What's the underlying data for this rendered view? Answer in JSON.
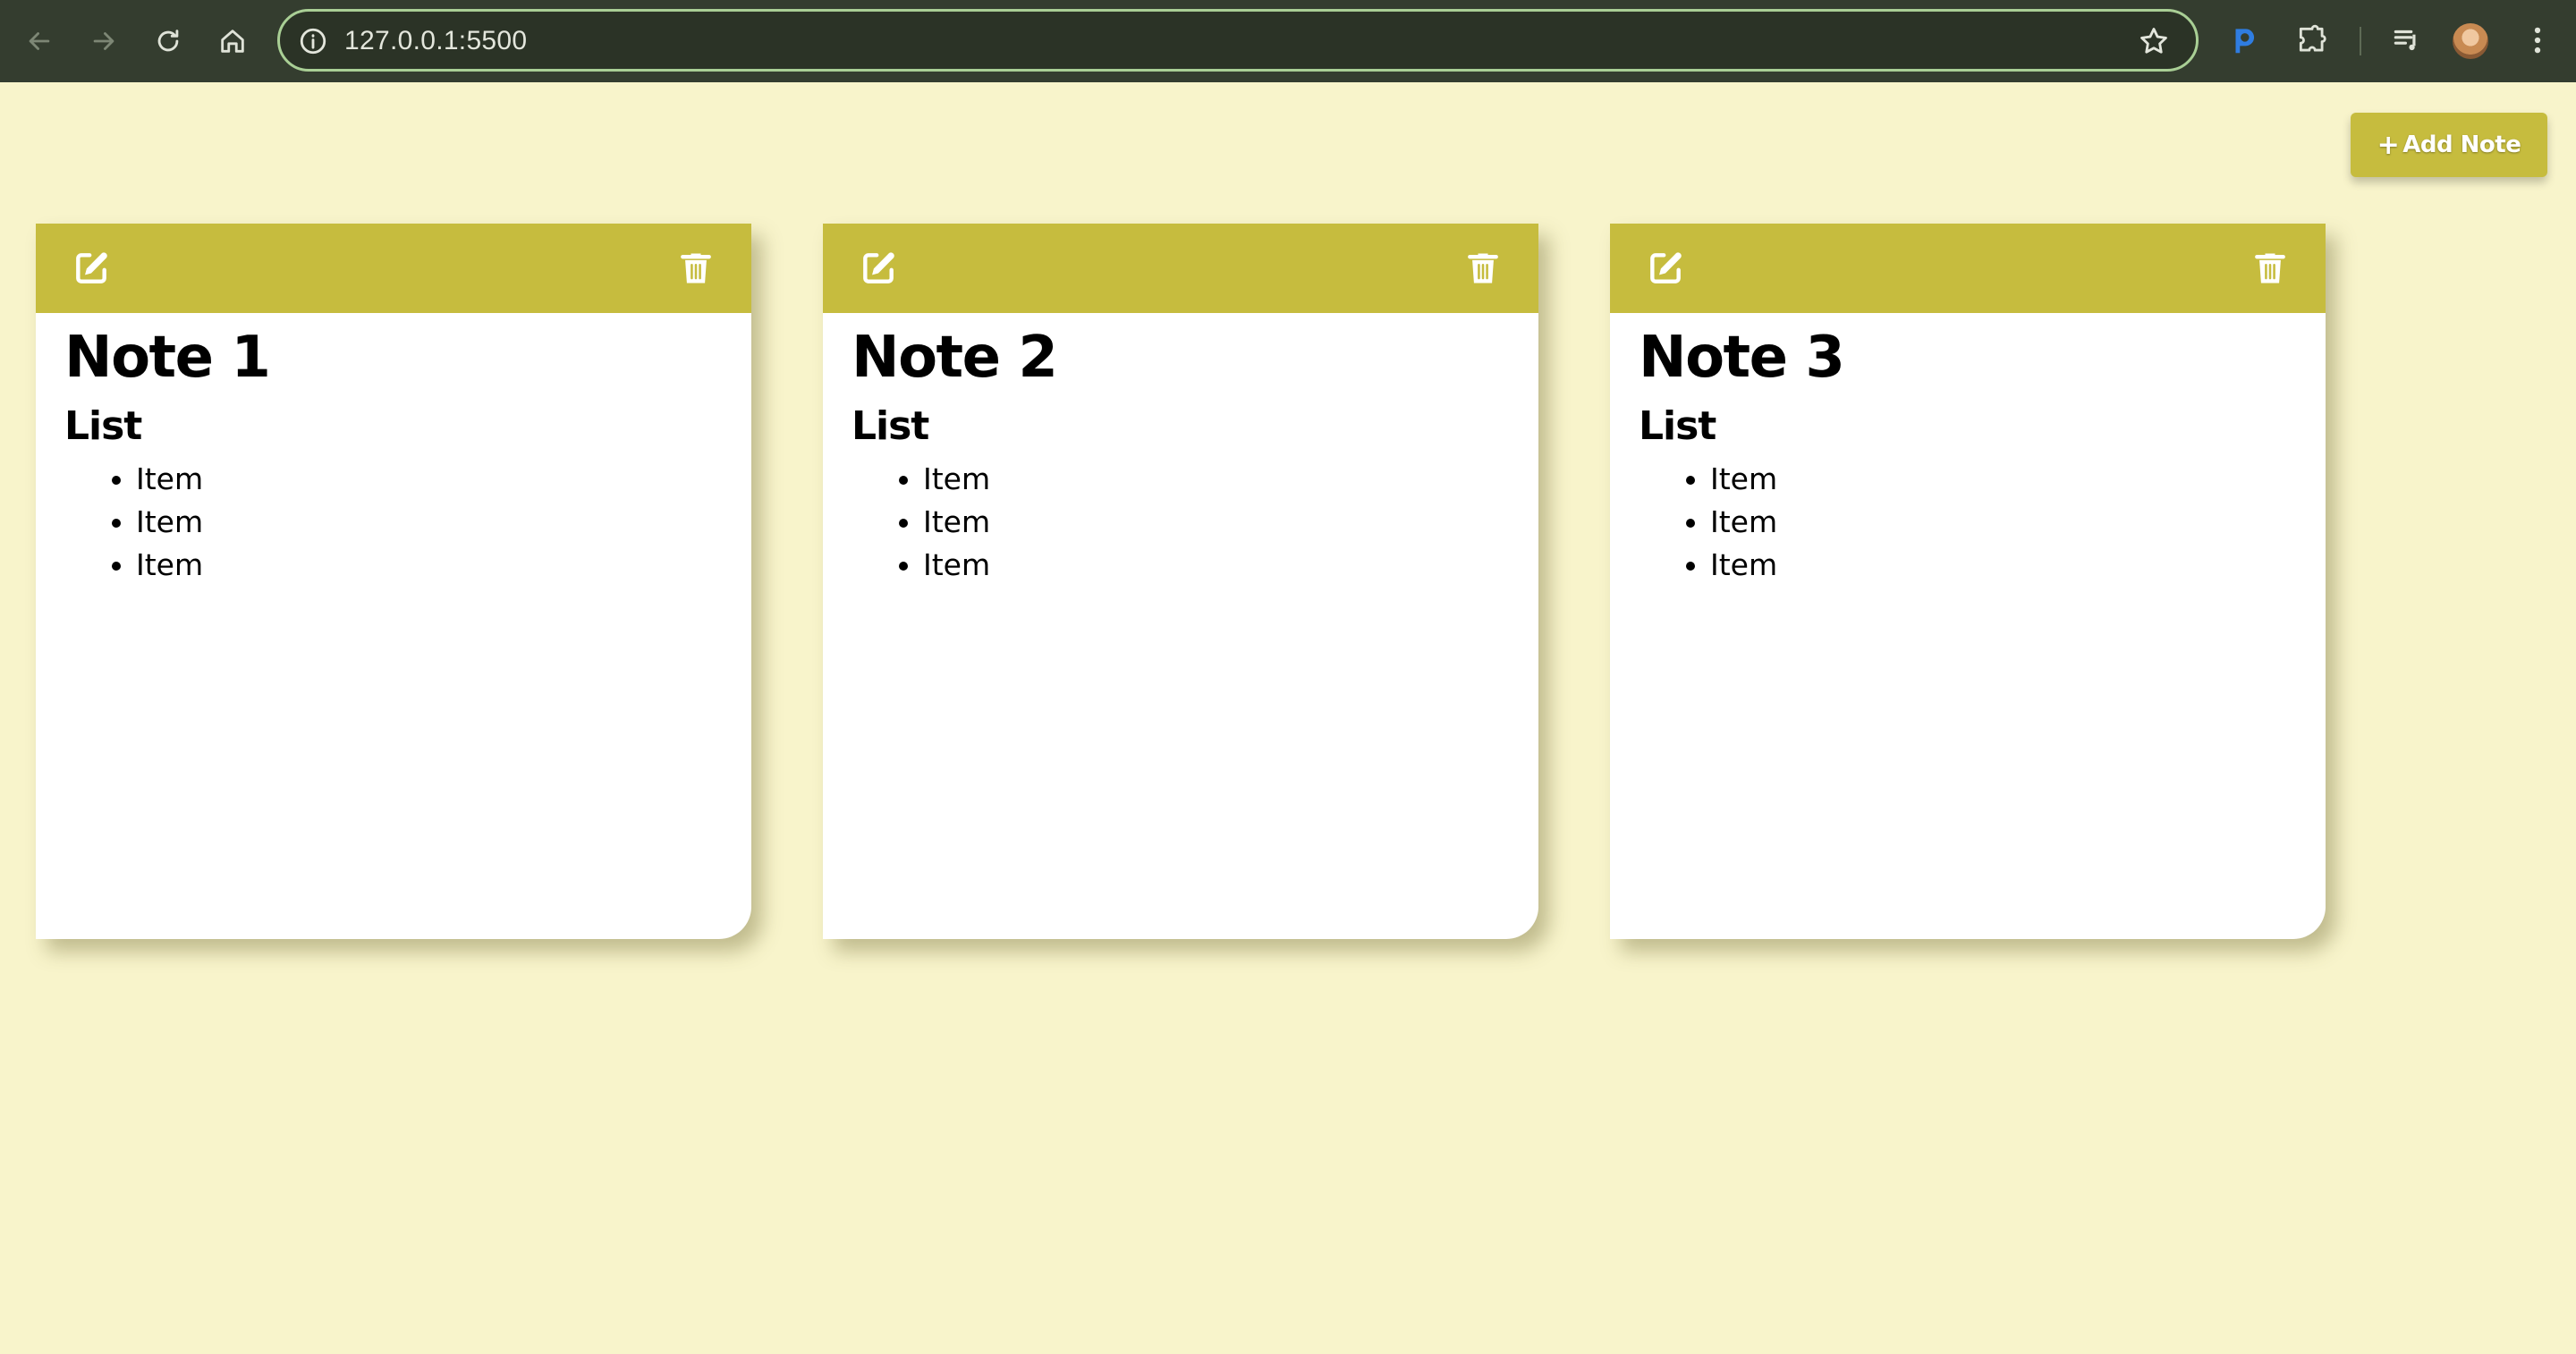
{
  "browser": {
    "url": "127.0.0.1:5500",
    "accent_color": "#a9cf95",
    "toolbar_color": "#343d2f"
  },
  "page": {
    "background": "#f8f4cb",
    "add_note_label": "Add Note",
    "add_note_icon": "+"
  },
  "notes": [
    {
      "title": "Note 1",
      "subtitle": "List",
      "items": [
        "Item",
        "Item",
        "Item"
      ]
    },
    {
      "title": "Note 2",
      "subtitle": "List",
      "items": [
        "Item",
        "Item",
        "Item"
      ]
    },
    {
      "title": "Note 3",
      "subtitle": "List",
      "items": [
        "Item",
        "Item",
        "Item"
      ]
    }
  ],
  "colors": {
    "note_header": "#c6bc3e",
    "note_body": "#ffffff"
  },
  "icons": {
    "edit": "edit-icon",
    "delete": "trash-icon"
  }
}
